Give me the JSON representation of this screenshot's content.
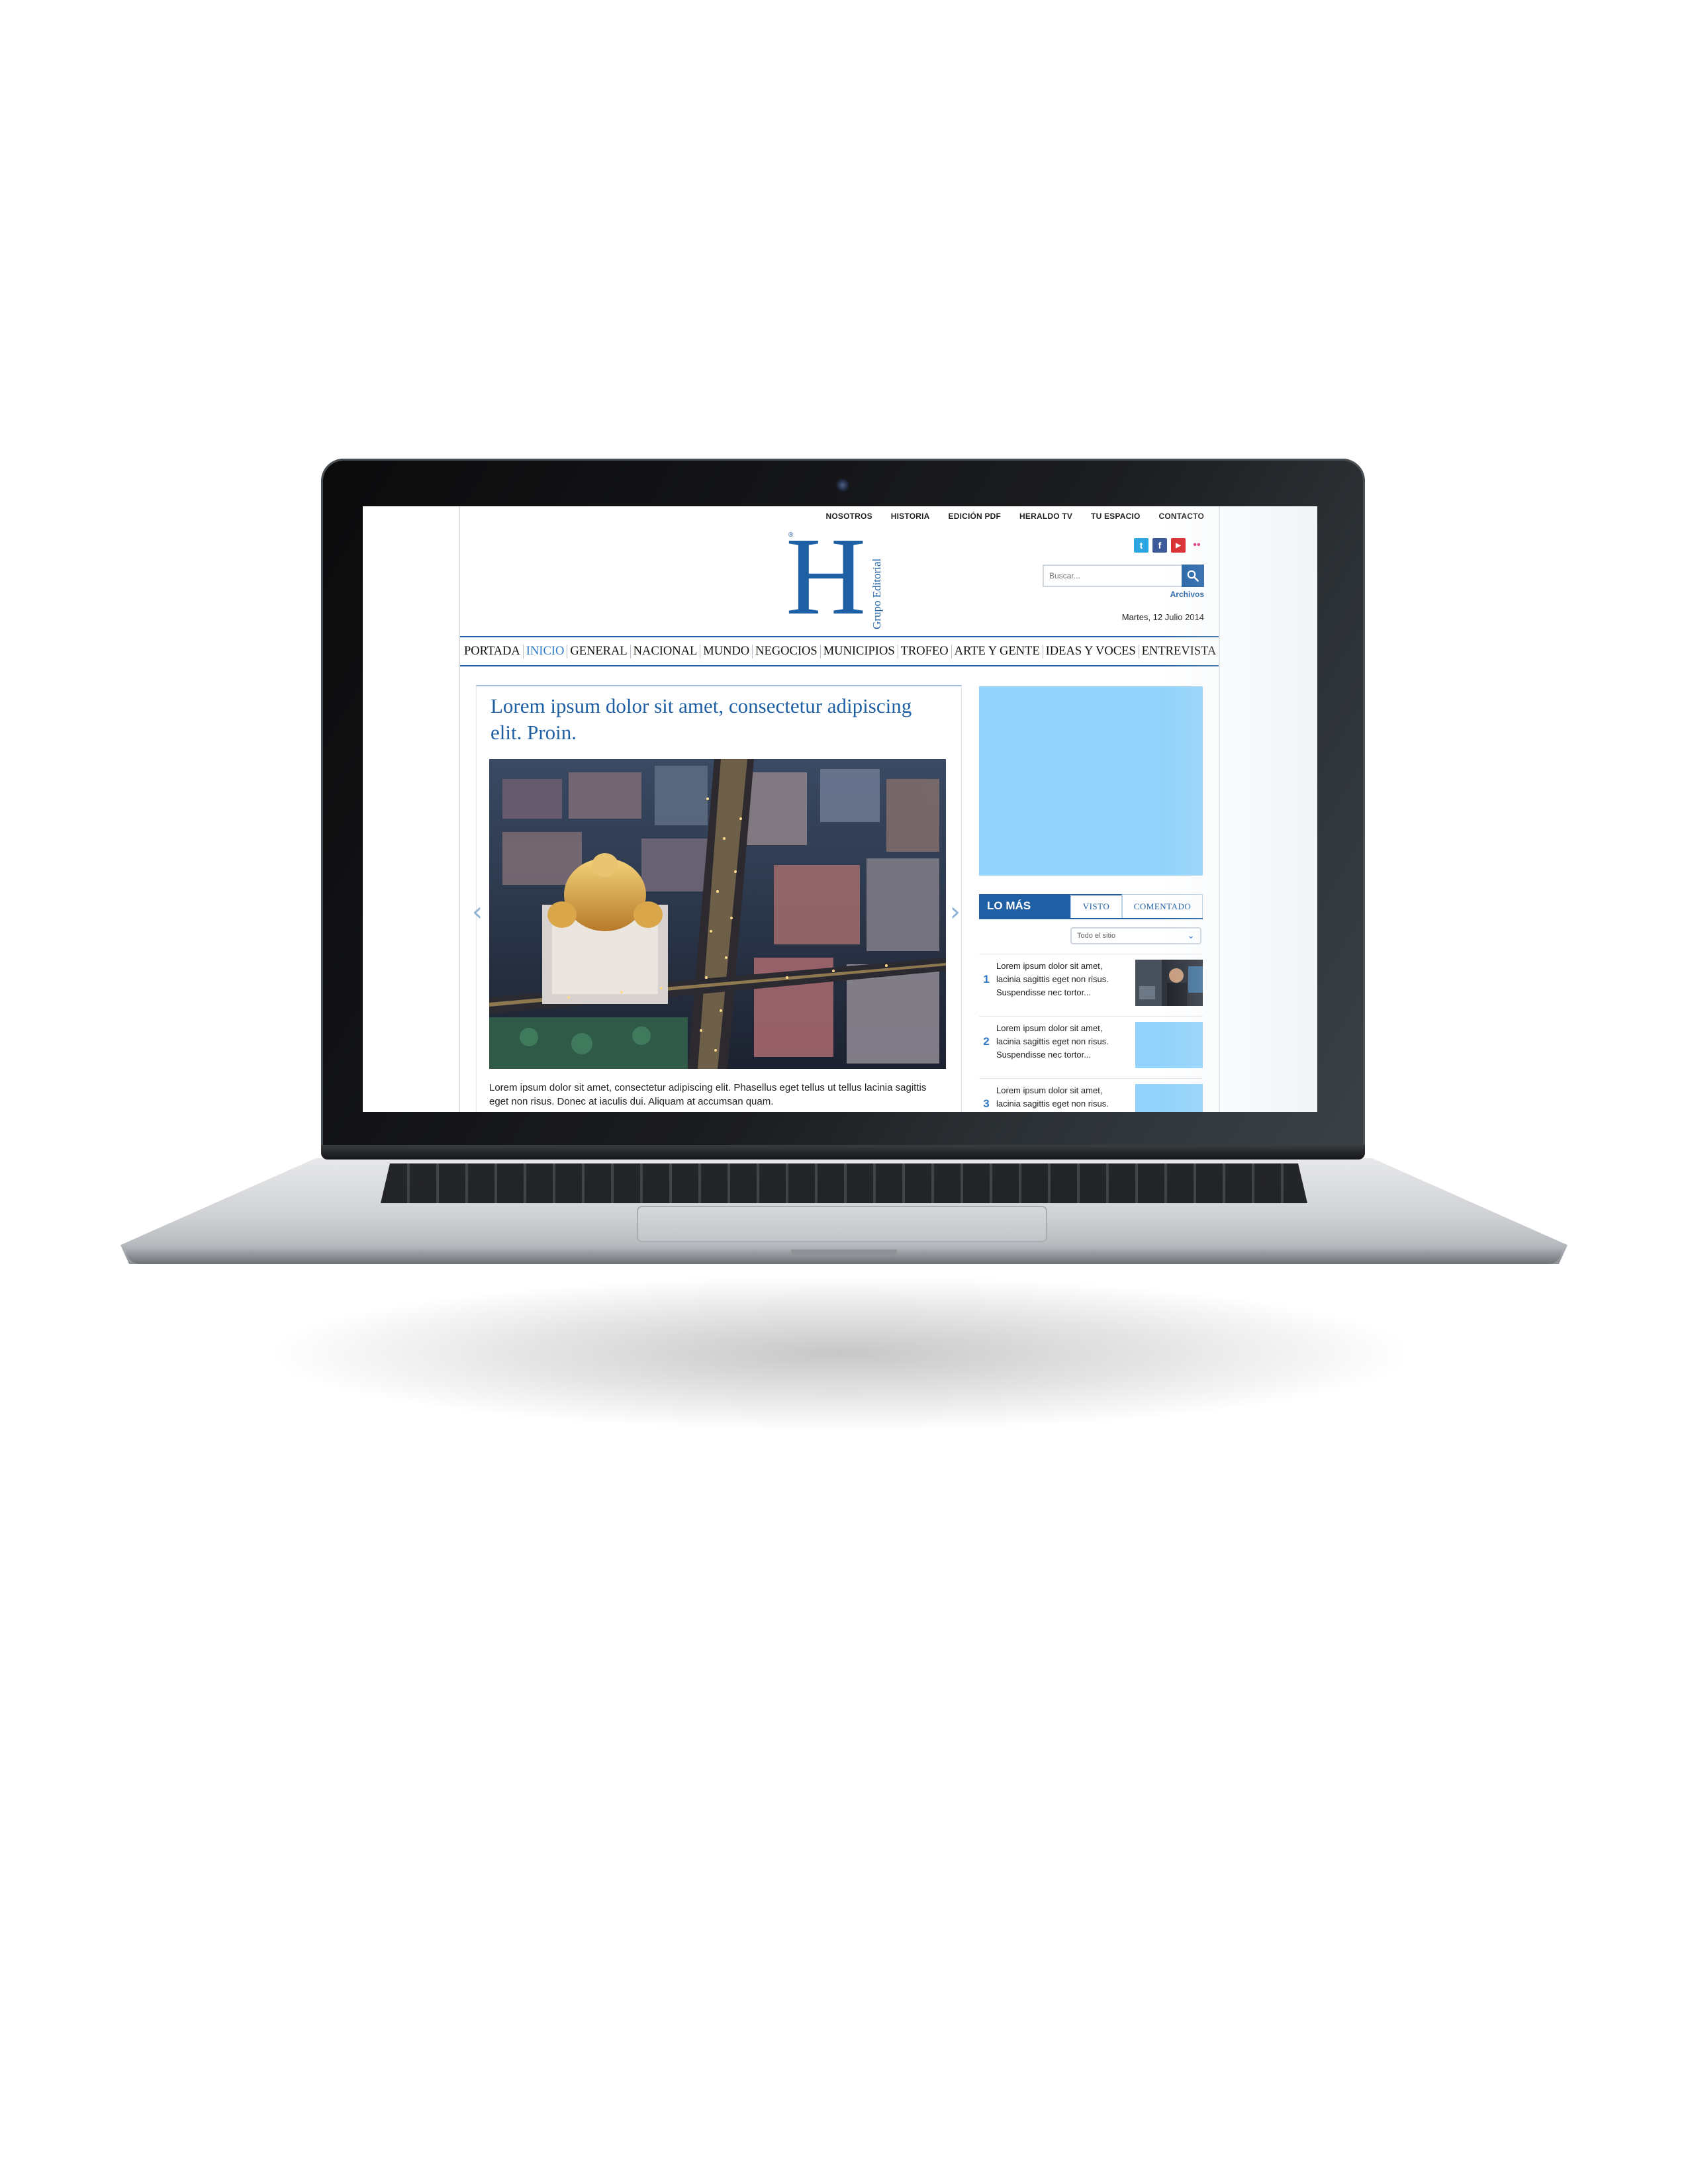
{
  "toplinks": [
    "NOSOTROS",
    "HISTORIA",
    "EDICIÓN PDF",
    "HERALDO TV",
    "TU ESPACIO",
    "CONTACTO"
  ],
  "logo": {
    "letter": "H",
    "registered": "®",
    "subtitle": "Grupo Editorial"
  },
  "social": [
    {
      "icon": "twitter-icon",
      "glyph": "t",
      "color": "#2ba6e1"
    },
    {
      "icon": "facebook-icon",
      "glyph": "f",
      "color": "#3b5998"
    },
    {
      "icon": "youtube-icon",
      "glyph": "▶",
      "color": "#d8272a"
    },
    {
      "icon": "flickr-icon",
      "glyph": "••",
      "color": "#e0337a"
    }
  ],
  "search": {
    "placeholder": "Buscar...",
    "archive_label": "Archivos"
  },
  "date": "Martes, 12 Julio 2014",
  "nav": {
    "items": [
      "PORTADA",
      "INICIO",
      "GENERAL",
      "NACIONAL",
      "MUNDO",
      "NEGOCIOS",
      "MUNICIPIOS",
      "TROFEO",
      "ARTE Y GENTE",
      "IDEAS Y VOCES",
      "ENTREVISTA"
    ],
    "active": "INICIO"
  },
  "article": {
    "headline": "Lorem ipsum dolor sit amet, consectetur adipiscing elit. Proin.",
    "summary": "Lorem ipsum dolor sit amet, consectetur adipiscing elit. Phasellus eget tellus ut tellus lacinia sagittis eget non risus. Donec at iaculis dui. Aliquam at accumsan quam.",
    "prev_arrow": "‹",
    "next_arrow": "›"
  },
  "most": {
    "title": "LO MÁS",
    "tabs": [
      "VISTO",
      "COMENTADO"
    ],
    "filter": "Todo el sitio",
    "filter_icon": "chevron-down-icon",
    "items": [
      {
        "num": "1",
        "text": "Lorem ipsum dolor sit amet, lacinia sagittis eget non risus. Suspendisse nec tortor..."
      },
      {
        "num": "2",
        "text": "Lorem ipsum dolor sit amet, lacinia sagittis eget non risus. Suspendisse nec tortor..."
      },
      {
        "num": "3",
        "text": "Lorem ipsum dolor sit amet, lacinia sagittis eget non risus. Suspendisse nec tortor..."
      }
    ]
  },
  "colors": {
    "brand": "#1f5fa4",
    "accent": "#2f79c6",
    "ad_placeholder": "#91d3fb"
  }
}
